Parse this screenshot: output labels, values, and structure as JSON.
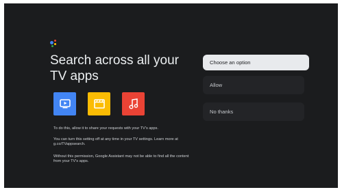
{
  "colors": {
    "screen_bg": "#1b1c1e",
    "assistant_dots": [
      "#4285f4",
      "#ea4335",
      "#fbbc05",
      "#34a853"
    ],
    "app_tiles": [
      "#4285f4",
      "#fbbc04",
      "#ea4335"
    ]
  },
  "prompt": {
    "title": "Search across all your TV apps",
    "apps": [
      {
        "name": "tv-app",
        "icon": "tv-play-icon"
      },
      {
        "name": "movies-app",
        "icon": "clapperboard-icon"
      },
      {
        "name": "music-app",
        "icon": "music-note-icon"
      }
    ],
    "paragraph_1": "To do this, allow it to share your requests with your TV's apps.",
    "paragraph_2": "You can turn this setting off at any time in your TV settings. Learn more at g.co/TVappsearch.",
    "paragraph_3": "Without this permission, Google Assistant may not be able to find all the content from your TV's apps."
  },
  "menu": {
    "header": "Choose an option",
    "options": [
      "Allow",
      "No thanks"
    ]
  }
}
